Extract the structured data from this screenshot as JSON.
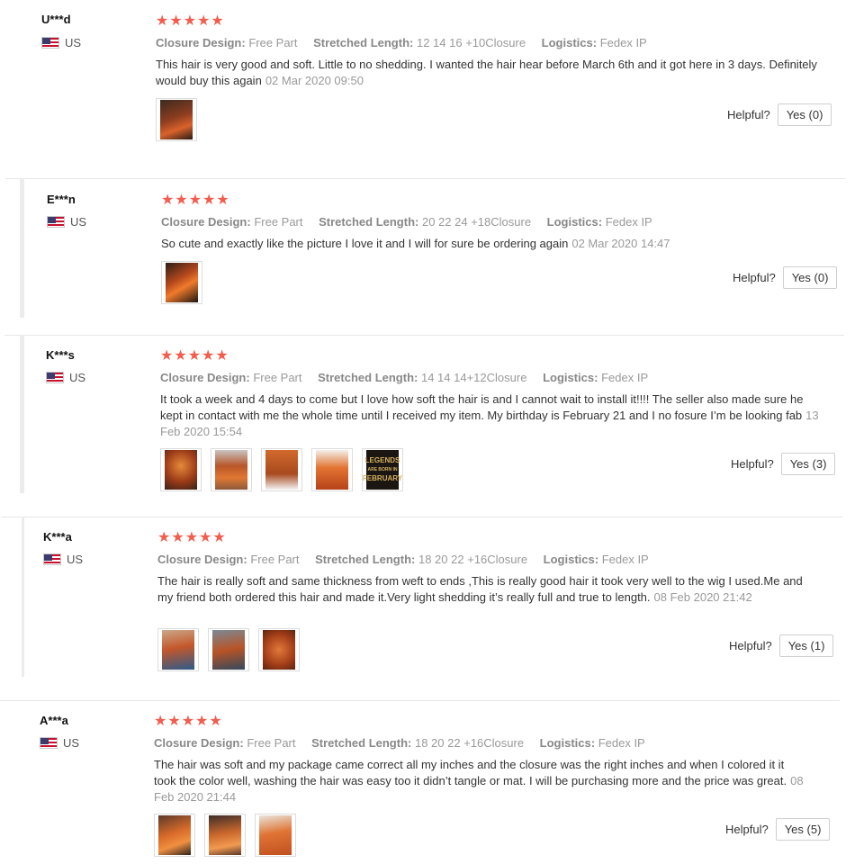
{
  "labels": {
    "closure": "Closure Design:",
    "stretched": "Stretched Length:",
    "logistics": "Logistics:",
    "helpful": "Helpful?"
  },
  "colors": {
    "star": "#f25d4e",
    "meta_key": "#888888",
    "meta_value": "#999999"
  },
  "reviews": [
    {
      "user": "U***d",
      "country": "US",
      "flag_icon": "us-flag-icon",
      "stars": 5,
      "closure": "Free Part",
      "stretched": "12 14 16 +10Closure",
      "logistics": "Fedex IP",
      "text": "This hair is very good and soft. Little to no shedding. I wanted the hair hear before March 6th and it got here in 3 days. Definitely would buy this again",
      "date": "02 Mar 2020 09:50",
      "photos": 1,
      "helpful_label": "Yes (0)"
    },
    {
      "user": "E***n",
      "country": "US",
      "flag_icon": "us-flag-icon",
      "stars": 5,
      "closure": "Free Part",
      "stretched": "20 22 24 +18Closure",
      "logistics": "Fedex IP",
      "text": "So cute and exactly like the picture I love it and I will for sure be ordering again",
      "date": "02 Mar 2020 14:47",
      "photos": 1,
      "helpful_label": "Yes (0)"
    },
    {
      "user": "K***s",
      "country": "US",
      "flag_icon": "us-flag-icon",
      "stars": 5,
      "closure": "Free Part",
      "stretched": "14 14 14+12Closure",
      "logistics": "Fedex IP",
      "text": "It took a week and 4 days to come but I love how soft the hair is and I cannot wait to install it!!!! The seller also made sure he kept in contact with me the whole time until I received my item. My birthday is February 21 and I no fosure I’m be looking fab",
      "date": "13 Feb 2020 15:54",
      "photos": 5,
      "photo_caption": [
        "LEGENDS",
        "ARE BORN IN",
        "FEBRUARY"
      ],
      "helpful_label": "Yes (3)"
    },
    {
      "user": "K***a",
      "country": "US",
      "flag_icon": "us-flag-icon",
      "stars": 5,
      "closure": "Free Part",
      "stretched": "18 20 22 +16Closure",
      "logistics": "Fedex IP",
      "text": "The hair is really soft and same thickness from weft to ends ,This is really good hair it took very well to the wig I used.Me and my friend both ordered this hair and made it.Very light shedding it’s really full and true to length.",
      "date": "08 Feb 2020 21:42",
      "photos": 3,
      "helpful_label": "Yes (1)"
    },
    {
      "user": "A***a",
      "country": "US",
      "flag_icon": "us-flag-icon",
      "stars": 5,
      "closure": "Free Part",
      "stretched": "18 20 22 +16Closure",
      "logistics": "Fedex IP",
      "text": "The hair was soft and my package came correct all my inches and the closure was the right inches and when I colored it it took the color well, washing the hair was easy too it didn’t tangle or mat. I will be purchasing more and the price was great.",
      "date": "08 Feb 2020 21:44",
      "photos": 3,
      "helpful_label": "Yes (5)"
    }
  ]
}
